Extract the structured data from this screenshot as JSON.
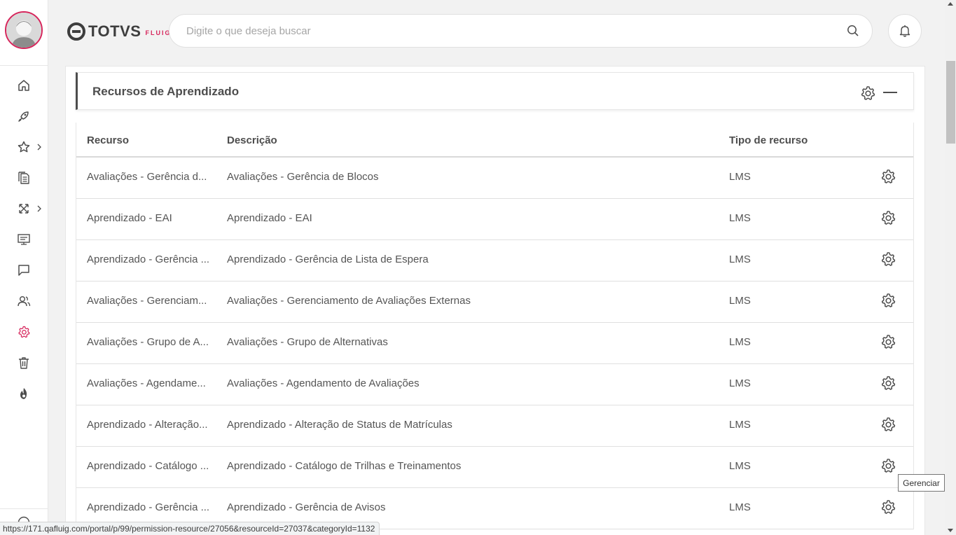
{
  "colors": {
    "accent": "#d6255b",
    "text": "#4d4d4d",
    "icon": "#4d4d4d"
  },
  "header": {
    "logo_text": "TOTVS",
    "logo_sub": "FLUIG",
    "search_placeholder": "Digite o que deseja buscar"
  },
  "sidebar": {
    "items": [
      {
        "name": "home",
        "icon": "home-icon"
      },
      {
        "name": "social",
        "icon": "rocket-icon"
      },
      {
        "name": "favorites",
        "icon": "star-icon",
        "has_submenu": true
      },
      {
        "name": "documents",
        "icon": "documents-icon"
      },
      {
        "name": "processes",
        "icon": "workflow-icon",
        "has_submenu": true
      },
      {
        "name": "pages",
        "icon": "presentation-icon"
      },
      {
        "name": "messages",
        "icon": "chat-icon"
      },
      {
        "name": "users",
        "icon": "users-icon"
      },
      {
        "name": "settings",
        "icon": "gear-icon",
        "active": true
      },
      {
        "name": "trash",
        "icon": "trash-icon"
      },
      {
        "name": "learning",
        "icon": "flame-icon"
      }
    ]
  },
  "widget": {
    "title": "Recursos de Aprendizado",
    "columns": [
      "Recurso",
      "Descrição",
      "Tipo de recurso"
    ],
    "rows": [
      {
        "resource": "Avaliações - Gerência d...",
        "description": "Avaliações - Gerência de Blocos",
        "type": "LMS"
      },
      {
        "resource": "Aprendizado - EAI",
        "description": "Aprendizado - EAI",
        "type": "LMS"
      },
      {
        "resource": "Aprendizado - Gerência ...",
        "description": "Aprendizado - Gerência de Lista de Espera",
        "type": "LMS"
      },
      {
        "resource": "Avaliações - Gerenciam...",
        "description": "Avaliações - Gerenciamento de Avaliações Externas",
        "type": "LMS"
      },
      {
        "resource": "Avaliações - Grupo de A...",
        "description": "Avaliações - Grupo de Alternativas",
        "type": "LMS"
      },
      {
        "resource": "Avaliações - Agendame...",
        "description": "Avaliações - Agendamento de Avaliações",
        "type": "LMS"
      },
      {
        "resource": "Aprendizado - Alteração...",
        "description": "Aprendizado - Alteração de Status de Matrículas",
        "type": "LMS"
      },
      {
        "resource": "Aprendizado - Catálogo ...",
        "description": "Aprendizado - Catálogo de Trilhas e Treinamentos",
        "type": "LMS"
      },
      {
        "resource": "Aprendizado - Gerência ...",
        "description": "Aprendizado - Gerência de Avisos",
        "type": "LMS"
      }
    ]
  },
  "tooltip": "Gerenciar",
  "status_url": "https://171.qafluig.com/portal/p/99/permission-resource/27056&resourceId=27037&categoryId=1132"
}
